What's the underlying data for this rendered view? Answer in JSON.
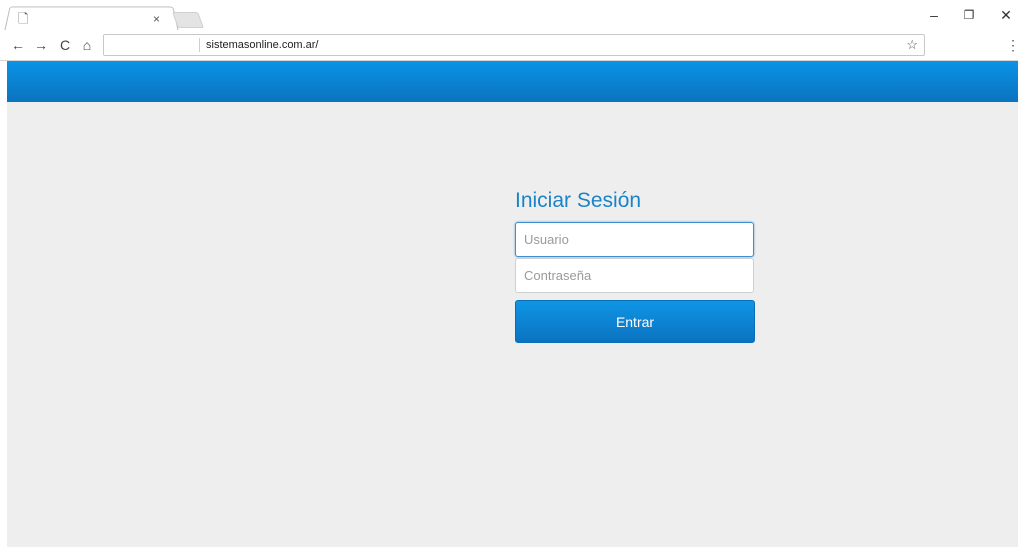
{
  "browser": {
    "tab": {
      "icon": "page-icon",
      "title": "",
      "close_icon": "close-icon"
    },
    "window_controls": {
      "minimize": "–",
      "restore": "❐",
      "close": "✕"
    },
    "nav": {
      "back": "←",
      "forward": "→",
      "reload": "C",
      "home": "⌂"
    },
    "address": "sistemasonline.com.ar/",
    "star": "☆",
    "menu": "⋮"
  },
  "colors": {
    "header_top": "#0a93e6",
    "header_bottom": "#0b73bf",
    "page_bg": "#eeeeee",
    "title": "#1b84c8",
    "button": "#0b80d3"
  },
  "login": {
    "title": "Iniciar Sesión",
    "username_placeholder": "Usuario",
    "password_placeholder": "Contraseña",
    "submit_label": "Entrar"
  }
}
